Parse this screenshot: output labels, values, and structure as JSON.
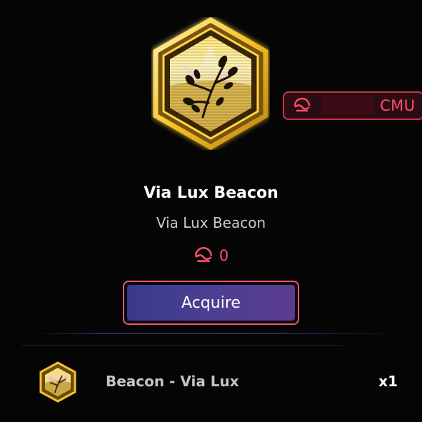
{
  "item": {
    "title": "Via Lux Beacon",
    "subtitle": "Via Lux Beacon",
    "price": "0",
    "badge_icon": "via-lux-beacon-badge"
  },
  "currency": {
    "label": "CMU",
    "icon": "currency-icon",
    "color": "#ff4f6d"
  },
  "actions": {
    "acquire_label": "Acquire"
  },
  "inventory": {
    "items": [
      {
        "label": "Beacon - Via Lux",
        "quantity": "x1",
        "icon": "via-lux-beacon-badge"
      }
    ]
  },
  "colors": {
    "background": "#050506",
    "accent": "#ff4f6d",
    "button_start": "#3a3a8a",
    "button_end": "#5c3c8e",
    "badge_gold": "#f2c230"
  }
}
